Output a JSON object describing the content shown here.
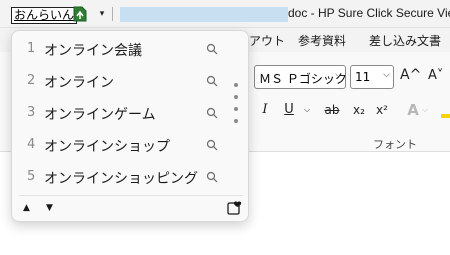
{
  "titlebar": {
    "ime_composition": "おんらいん",
    "window_title": "doc - HP Sure Click Secure View",
    "qat_dropdown_glyph": "▾"
  },
  "ribbon": {
    "tabs": [
      "アウト",
      "参考資料",
      "差し込み文書"
    ],
    "font_name": "ＭＳ Ｐゴシック",
    "font_size": "11",
    "grow_font": "A^",
    "shrink_font": "A˅",
    "buttons": {
      "italic": "I",
      "underline": "U",
      "strike": "ab",
      "subscript": "x₂",
      "superscript": "x²",
      "text_effect": "A"
    },
    "group_label": "フォント"
  },
  "ime": {
    "candidates": [
      {
        "num": "1",
        "text": "オンライン会議"
      },
      {
        "num": "2",
        "text": "オンライン"
      },
      {
        "num": "3",
        "text": "オンラインゲーム"
      },
      {
        "num": "4",
        "text": "オンラインショップ"
      },
      {
        "num": "5",
        "text": "オンラインショッピング"
      }
    ],
    "up_glyph": "▲",
    "down_glyph": "▼",
    "icons": {
      "search": "search-icon",
      "library": "dictionary-icon"
    }
  },
  "colors": {
    "highlight_yellow": "#f5d400",
    "filename_block": "#c8dff1"
  }
}
